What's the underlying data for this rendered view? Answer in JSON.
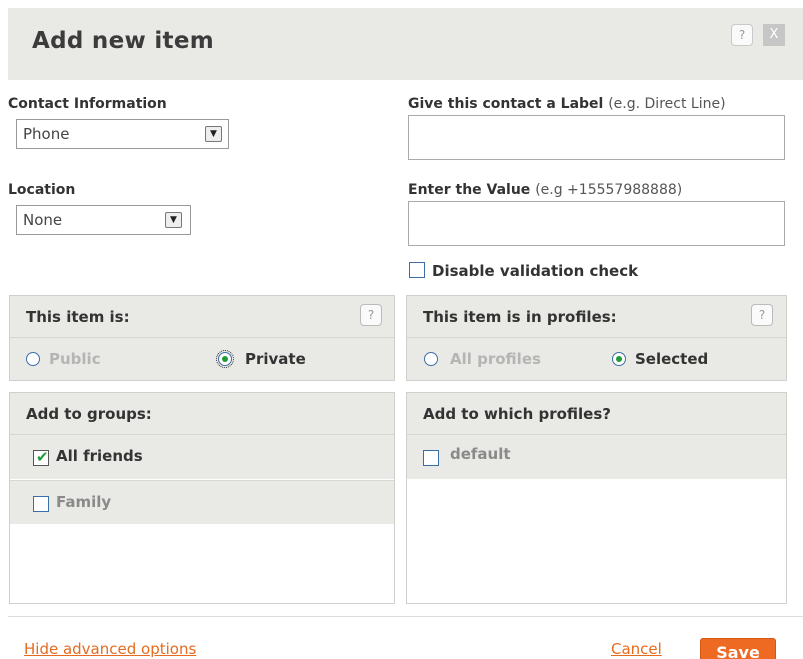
{
  "dialog": {
    "title": "Add new item",
    "help_label": "?",
    "close_label": "X"
  },
  "contact_info": {
    "label": "Contact Information",
    "selected": "Phone"
  },
  "location": {
    "label": "Location",
    "selected": "None"
  },
  "label_field": {
    "label": "Give this contact a Label",
    "hint": "(e.g. Direct Line)",
    "value": ""
  },
  "value_field": {
    "label": "Enter the Value",
    "hint": "(e.g +15557988888)",
    "value": ""
  },
  "disable_validation": {
    "label": "Disable validation check",
    "checked": false
  },
  "visibility": {
    "title": "This item is:",
    "help_label": "?",
    "options": [
      {
        "label": "Public",
        "selected": false
      },
      {
        "label": "Private",
        "selected": true
      }
    ]
  },
  "profiles_scope": {
    "title": "This item is in profiles:",
    "help_label": "?",
    "options": [
      {
        "label": "All profiles",
        "selected": false
      },
      {
        "label": "Selected",
        "selected": true
      }
    ]
  },
  "groups": {
    "title": "Add to groups:",
    "items": [
      {
        "label": "All friends",
        "checked": true
      },
      {
        "label": "Family",
        "checked": false
      }
    ]
  },
  "profiles": {
    "title": "Add to which profiles?",
    "items": [
      {
        "label": "default",
        "checked": false
      }
    ]
  },
  "footer": {
    "advanced_link": "Hide advanced options",
    "cancel_label": "Cancel",
    "save_label": "Save"
  },
  "colors": {
    "accent": "#ee6a22",
    "link": "#e56b1f",
    "panel_bg": "#e9e9e5",
    "check_green": "#1f9b3a"
  },
  "icons": [
    "help-icon",
    "close-icon",
    "dropdown-arrow-icon",
    "checkmark-icon"
  ]
}
